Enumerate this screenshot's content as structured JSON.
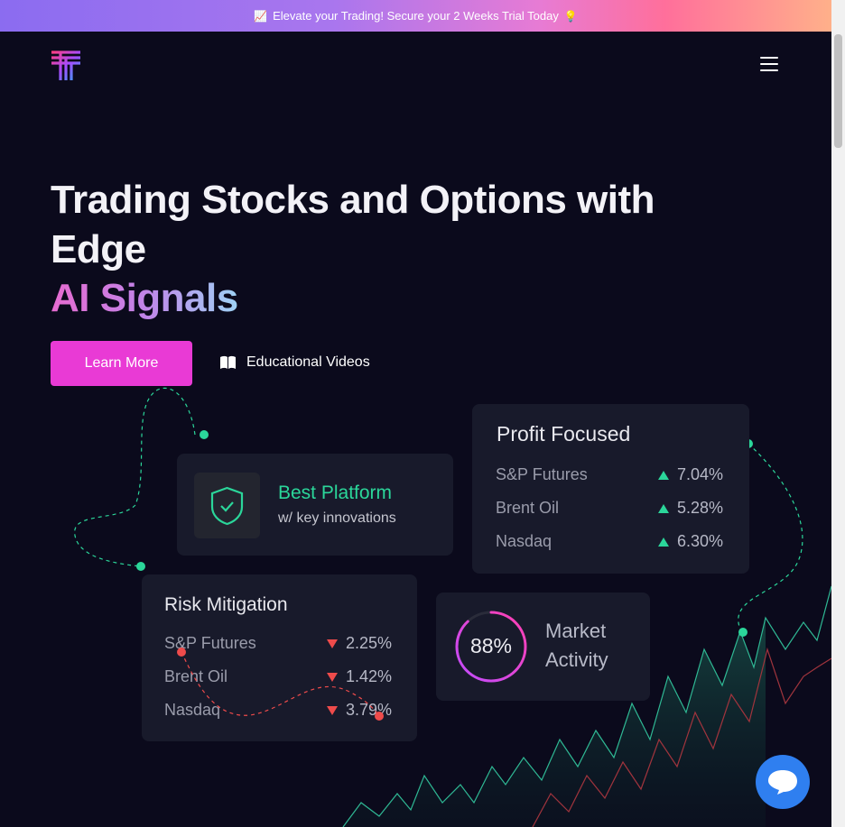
{
  "banner": {
    "prefix_icon": "chart-emoji",
    "text": "Elevate your Trading! Secure your 2 Weeks Trial Today",
    "suffix_icon": "lightbulb-emoji"
  },
  "header": {
    "logo": "T-logo",
    "menu_icon": "hamburger-icon"
  },
  "hero": {
    "title": "Trading Stocks and Options with Edge",
    "highlight": "AI Signals",
    "primary_button": "Learn More",
    "secondary_link": "Educational Videos",
    "secondary_icon": "book-icon"
  },
  "cards": {
    "platform": {
      "title": "Best Platform",
      "subtitle": "w/ key innovations",
      "icon": "shield-check-icon"
    },
    "profit": {
      "title": "Profit Focused",
      "rows": [
        {
          "label": "S&P Futures",
          "value": "7.04%",
          "trend": "up"
        },
        {
          "label": "Brent Oil",
          "value": "5.28%",
          "trend": "up"
        },
        {
          "label": "Nasdaq",
          "value": "6.30%",
          "trend": "up"
        }
      ]
    },
    "risk": {
      "title": "Risk Mitigation",
      "rows": [
        {
          "label": "S&P Futures",
          "value": "2.25%",
          "trend": "down"
        },
        {
          "label": "Brent Oil",
          "value": "1.42%",
          "trend": "down"
        },
        {
          "label": "Nasdaq",
          "value": "3.79%",
          "trend": "down"
        }
      ]
    },
    "activity": {
      "percent": "88%",
      "progress": 0.88,
      "label_line1": "Market",
      "label_line2": "Activity"
    }
  },
  "colors": {
    "accent": "#e93ad5",
    "up": "#2bd69a",
    "down": "#ee4b4b",
    "background": "#0b0a1c",
    "card": "#181a2b"
  },
  "chat": {
    "icon": "chat-bubble-icon"
  }
}
